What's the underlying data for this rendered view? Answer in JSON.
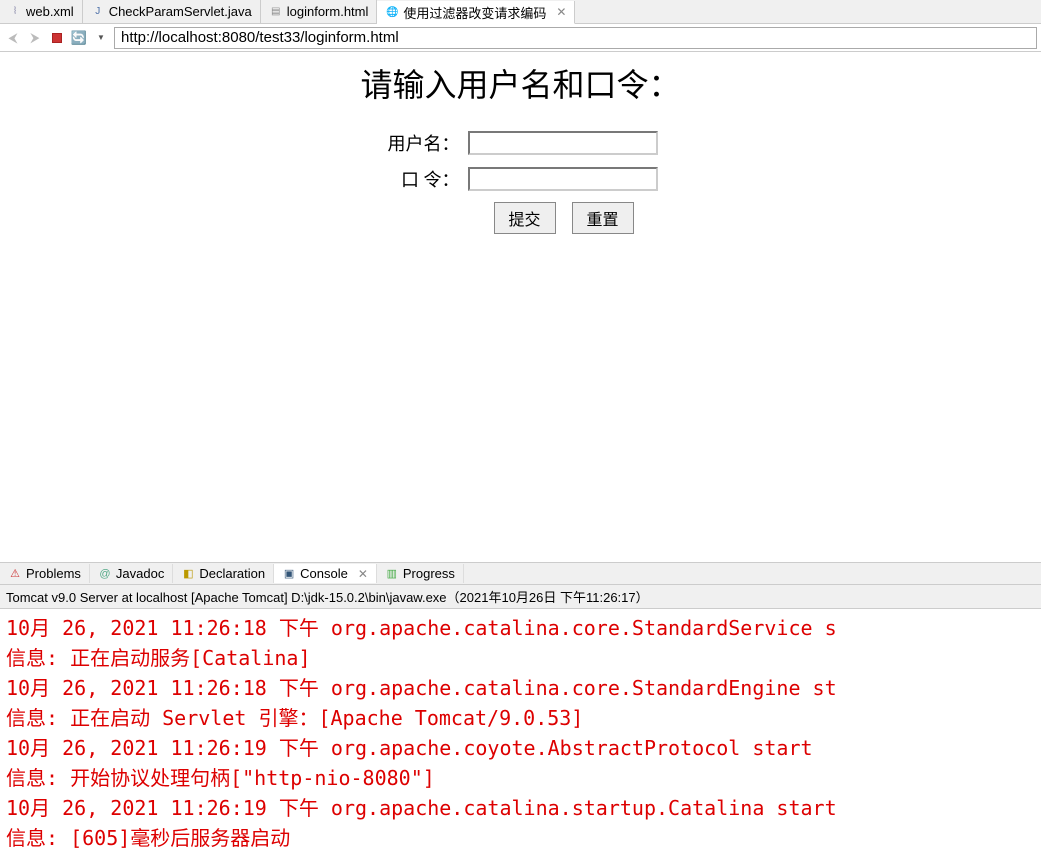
{
  "editor_tabs": {
    "t0": {
      "label": "web.xml"
    },
    "t1": {
      "label": "CheckParamServlet.java"
    },
    "t2": {
      "label": "loginform.html"
    },
    "t3": {
      "label": "使用过滤器改变请求编码"
    }
  },
  "nav": {
    "url": "http://localhost:8080/test33/loginform.html"
  },
  "page": {
    "heading": "请输入用户名和口令：",
    "user_label": "用户名：",
    "pass_label": "口  令：",
    "submit_label": "提交",
    "reset_label": "重置"
  },
  "bottom_tabs": {
    "problems": "Problems",
    "javadoc": "Javadoc",
    "declaration": "Declaration",
    "console": "Console",
    "progress": "Progress"
  },
  "console": {
    "header": "Tomcat v9.0 Server at localhost [Apache Tomcat] D:\\jdk-15.0.2\\bin\\javaw.exe（2021年10月26日 下午11:26:17）",
    "lines": "10月 26, 2021 11:26:18 下午 org.apache.catalina.core.StandardService s\n信息: 正在启动服务[Catalina]\n10月 26, 2021 11:26:18 下午 org.apache.catalina.core.StandardEngine st\n信息: 正在启动 Servlet 引擎：[Apache Tomcat/9.0.53]\n10月 26, 2021 11:26:19 下午 org.apache.coyote.AbstractProtocol start\n信息: 开始协议处理句柄[\"http-nio-8080\"]\n10月 26, 2021 11:26:19 下午 org.apache.catalina.startup.Catalina start\n信息: [605]毫秒后服务器启动"
  }
}
